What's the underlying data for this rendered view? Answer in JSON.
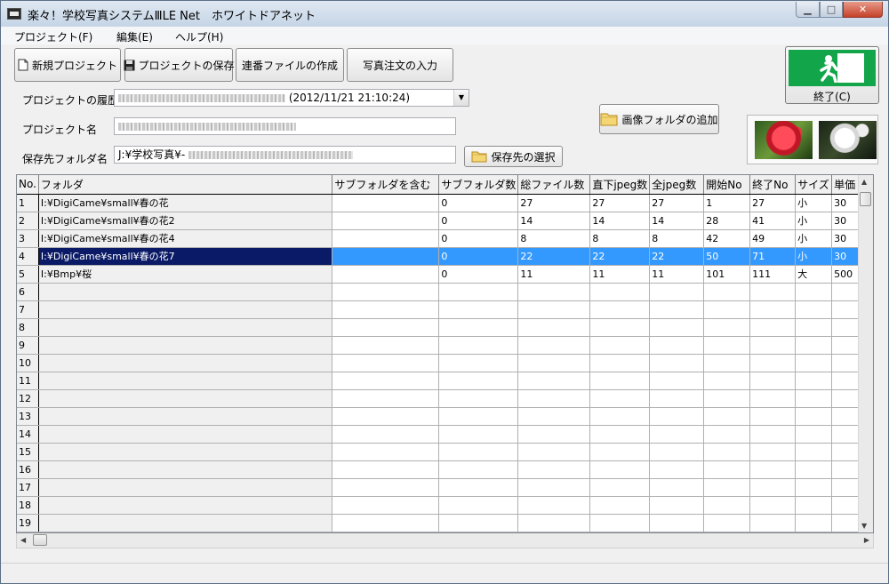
{
  "window": {
    "title": "楽々！学校写真システムⅢLE Net　ホワイトドアネット"
  },
  "menu": [
    {
      "label": "プロジェクト(F)"
    },
    {
      "label": "編集(E)"
    },
    {
      "label": "ヘルプ(H)"
    }
  ],
  "toolbar": {
    "new_project": "新規プロジェクト",
    "save_project": "プロジェクトの保存",
    "create_serial_file": "連番ファイルの作成",
    "photo_order_input": "写真注文の入力",
    "add_image_folder": "画像フォルダの追加",
    "select_save_dest": "保存先の選択",
    "exit": "終了(C)"
  },
  "form": {
    "history_label": "プロジェクトの履歴",
    "history_value_suffix": "(2012/11/21 21:10:24)",
    "name_label": "プロジェクト名",
    "folder_label": "保存先フォルダ名",
    "folder_value_prefix": "J:¥学校写真¥-"
  },
  "grid": {
    "columns": [
      "No.",
      "フォルダ",
      "サブフォルダを含む",
      "サブフォルダ数",
      "総ファイル数",
      "直下jpeg数",
      "全jpeg数",
      "開始No",
      "終了No",
      "サイズ",
      "単価"
    ],
    "rows": [
      [
        "1",
        "I:¥DigiCame¥small¥春の花",
        "",
        "0",
        "27",
        "27",
        "27",
        "1",
        "27",
        "小",
        "30"
      ],
      [
        "2",
        "I:¥DigiCame¥small¥春の花2",
        "",
        "0",
        "14",
        "14",
        "14",
        "28",
        "41",
        "小",
        "30"
      ],
      [
        "3",
        "I:¥DigiCame¥small¥春の花4",
        "",
        "0",
        "8",
        "8",
        "8",
        "42",
        "49",
        "小",
        "30"
      ],
      [
        "4",
        "I:¥DigiCame¥small¥春の花7",
        "",
        "0",
        "22",
        "22",
        "22",
        "50",
        "71",
        "小",
        "30"
      ],
      [
        "5",
        "I:¥Bmp¥桜",
        "",
        "0",
        "11",
        "11",
        "11",
        "101",
        "111",
        "大",
        "500"
      ],
      [
        "6",
        "",
        "",
        "",
        "",
        "",
        "",
        "",
        "",
        "",
        ""
      ],
      [
        "7",
        "",
        "",
        "",
        "",
        "",
        "",
        "",
        "",
        "",
        ""
      ],
      [
        "8",
        "",
        "",
        "",
        "",
        "",
        "",
        "",
        "",
        "",
        ""
      ],
      [
        "9",
        "",
        "",
        "",
        "",
        "",
        "",
        "",
        "",
        "",
        ""
      ],
      [
        "10",
        "",
        "",
        "",
        "",
        "",
        "",
        "",
        "",
        "",
        ""
      ],
      [
        "11",
        "",
        "",
        "",
        "",
        "",
        "",
        "",
        "",
        "",
        ""
      ],
      [
        "12",
        "",
        "",
        "",
        "",
        "",
        "",
        "",
        "",
        "",
        ""
      ],
      [
        "13",
        "",
        "",
        "",
        "",
        "",
        "",
        "",
        "",
        "",
        ""
      ],
      [
        "14",
        "",
        "",
        "",
        "",
        "",
        "",
        "",
        "",
        "",
        ""
      ],
      [
        "15",
        "",
        "",
        "",
        "",
        "",
        "",
        "",
        "",
        "",
        ""
      ],
      [
        "16",
        "",
        "",
        "",
        "",
        "",
        "",
        "",
        "",
        "",
        ""
      ],
      [
        "17",
        "",
        "",
        "",
        "",
        "",
        "",
        "",
        "",
        "",
        ""
      ],
      [
        "18",
        "",
        "",
        "",
        "",
        "",
        "",
        "",
        "",
        "",
        ""
      ],
      [
        "19",
        "",
        "",
        "",
        "",
        "",
        "",
        "",
        "",
        "",
        ""
      ]
    ],
    "selected_row_index": 3
  },
  "icons": {
    "app": "app-icon",
    "new": "new-document-icon",
    "save": "floppy-disk-icon",
    "folder": "folder-icon",
    "exit": "emergency-exit-icon"
  },
  "colors": {
    "selection": "#3399ff",
    "selected_folder_cell": "#0a1a66",
    "exit_sign": "#13a54a"
  }
}
